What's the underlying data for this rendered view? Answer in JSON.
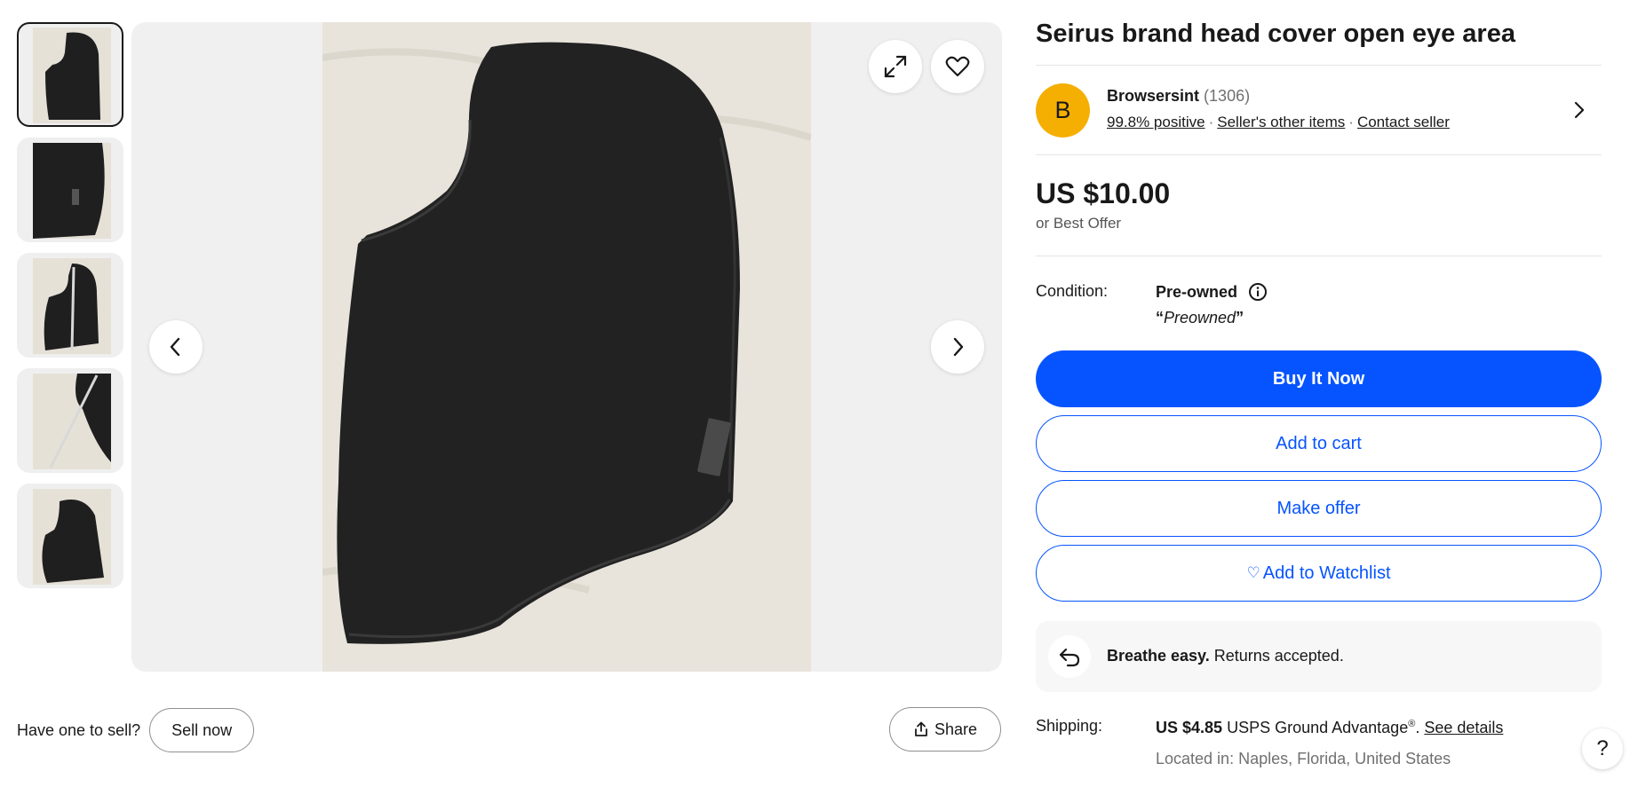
{
  "listing": {
    "title": "Seirus brand head cover open eye area"
  },
  "seller": {
    "initial": "B",
    "name": "Browsersint",
    "feedback_count": "(1306)",
    "positive": "99.8% positive",
    "other_items": "Seller's other items",
    "contact": "Contact seller"
  },
  "price": {
    "amount": "US $10.00",
    "best_offer": "or Best Offer"
  },
  "condition": {
    "label": "Condition:",
    "value": "Pre-owned",
    "note_open": "“",
    "note": "Preowned",
    "note_close": "”"
  },
  "actions": {
    "buy_now": "Buy It Now",
    "add_to_cart": "Add to cart",
    "make_offer": "Make offer",
    "watchlist_icon": "♡",
    "watchlist": "Add to Watchlist"
  },
  "returns": {
    "bold": "Breathe easy.",
    "text": " Returns accepted."
  },
  "shipping": {
    "label": "Shipping:",
    "price": "US $4.85",
    "service": " USPS Ground Advantage",
    "reg": "®",
    "sep": ". ",
    "details": "See details",
    "located": "Located in: Naples, Florida, United States"
  },
  "sell": {
    "question": "Have one to sell?",
    "button": "Sell now"
  },
  "share": {
    "label": "Share"
  },
  "help": {
    "label": "?"
  },
  "gallery": {
    "thumbnail_count": 5,
    "active_thumbnail": 1
  },
  "icons": {
    "expand": "expand-icon",
    "favorite": "heart-icon",
    "prev": "chevron-left-icon",
    "next": "chevron-right-icon",
    "returns": "return-arrow-icon",
    "share": "share-icon",
    "info": "info-icon"
  },
  "colors": {
    "primary": "#0654ff",
    "avatar": "#f5af02",
    "text": "#191919",
    "muted": "#707070"
  }
}
